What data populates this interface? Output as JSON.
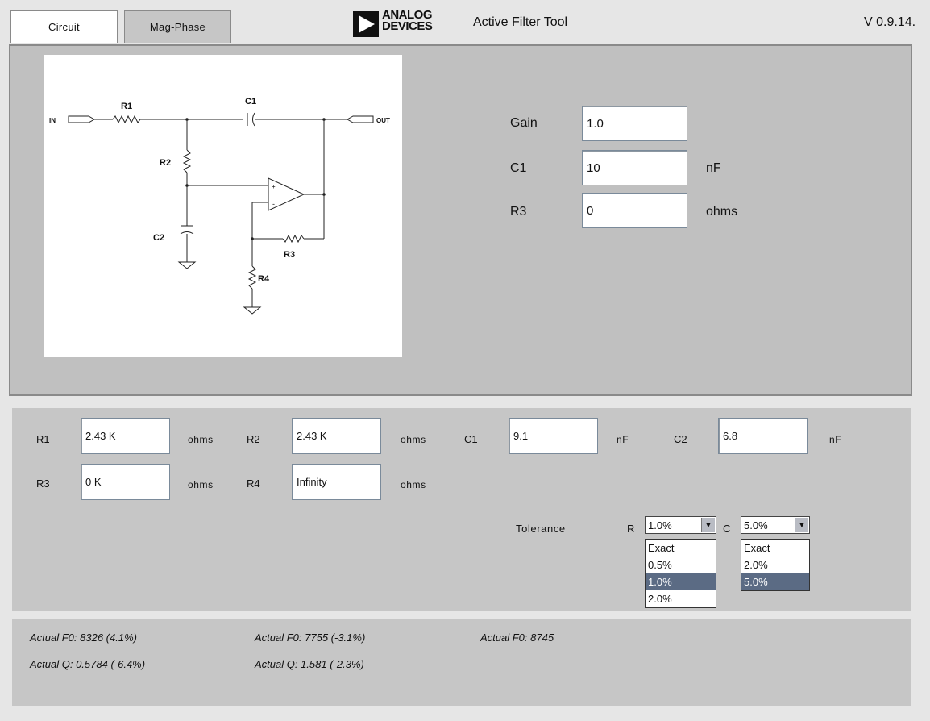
{
  "header": {
    "tabs": [
      {
        "label": "Circuit",
        "active": true
      },
      {
        "label": "Mag-Phase",
        "active": false
      }
    ],
    "brand_line1": "ANALOG",
    "brand_line2": "DEVICES",
    "title": "Active Filter Tool",
    "version": "V 0.9.14."
  },
  "schematic": {
    "labels": {
      "in": "IN",
      "out": "OUT",
      "r1": "R1",
      "r2": "R2",
      "r3": "R3",
      "r4": "R4",
      "c1": "C1",
      "c2": "C2",
      "plus": "+",
      "minus": "-"
    }
  },
  "design_params": {
    "gain": {
      "label": "Gain",
      "value": "1.0",
      "unit": ""
    },
    "c1": {
      "label": "C1",
      "value": "10",
      "unit": "nF"
    },
    "r3": {
      "label": "R3",
      "value": "0",
      "unit": "ohms"
    }
  },
  "components": {
    "r1": {
      "label": "R1",
      "value": "2.43 K",
      "unit": "ohms"
    },
    "r2": {
      "label": "R2",
      "value": "2.43 K",
      "unit": "ohms"
    },
    "c1": {
      "label": "C1",
      "value": "9.1",
      "unit": "nF"
    },
    "c2": {
      "label": "C2",
      "value": "6.8",
      "unit": "nF"
    },
    "r3": {
      "label": "R3",
      "value": "0 K",
      "unit": "ohms"
    },
    "r4": {
      "label": "R4",
      "value": "Infinity",
      "unit": "ohms"
    }
  },
  "tolerance": {
    "label": "Tolerance",
    "r": {
      "label": "R",
      "selected": "1.0%",
      "options": [
        "Exact",
        "0.5%",
        "1.0%",
        "2.0%"
      ]
    },
    "c": {
      "label": "C",
      "selected": "5.0%",
      "options": [
        "Exact",
        "2.0%",
        "5.0%"
      ]
    }
  },
  "results": {
    "col1": {
      "f0": "Actual F0: 8326 (4.1%)",
      "q": "Actual Q: 0.5784 (-6.4%)"
    },
    "col2": {
      "f0": "Actual F0: 7755 (-3.1%)",
      "q": "Actual Q: 1.581 (-2.3%)"
    },
    "col3": {
      "f0": "Actual F0: 8745"
    }
  },
  "colors": {
    "panel": "#c0c0c0",
    "background": "#e6e6e6",
    "selection": "#5b6b84"
  }
}
